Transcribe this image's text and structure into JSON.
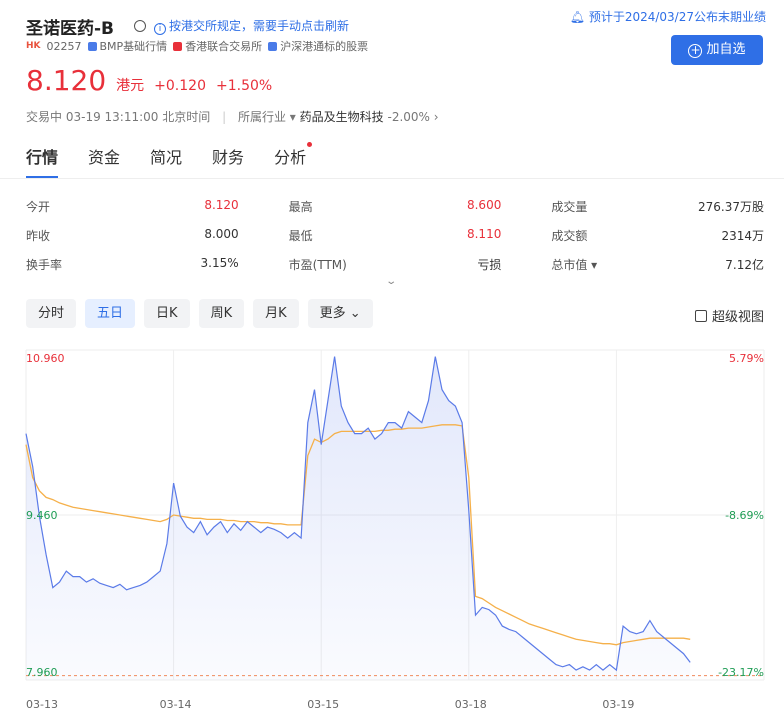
{
  "header": {
    "title": "圣诺医药-B",
    "notice": "按港交所规定，需要手动点击刷新",
    "forecast": "预计于2024/03/27公布末期业绩",
    "add_button": "加自选"
  },
  "tags": {
    "market": "HK",
    "code": "02257",
    "bmp": "BMP基础行情",
    "exchange": "香港联合交易所",
    "connect": "沪深港通标的股票"
  },
  "quote": {
    "price": "8.120",
    "currency": "港元",
    "change": "+0.120",
    "change_pct": "+1.50%"
  },
  "status": {
    "state": "交易中",
    "time": "03-19 13:11:00 北京时间",
    "industry_label": "所属行业",
    "industry": "药品及生物科技",
    "industry_chg": "-2.00%"
  },
  "tabs": [
    "行情",
    "资金",
    "简况",
    "财务",
    "分析"
  ],
  "stats": [
    [
      {
        "label": "今开",
        "value": "8.120",
        "red": true
      },
      {
        "label": "最高",
        "value": "8.600",
        "red": true
      },
      {
        "label": "成交量",
        "value": "276.37万股",
        "red": false
      }
    ],
    [
      {
        "label": "昨收",
        "value": "8.000",
        "red": false
      },
      {
        "label": "最低",
        "value": "8.110",
        "red": true
      },
      {
        "label": "成交额",
        "value": "2314万",
        "red": false
      }
    ],
    [
      {
        "label": "换手率",
        "value": "3.15%",
        "red": false
      },
      {
        "label": "市盈(TTM)",
        "value": "亏损",
        "red": false
      },
      {
        "label": "总市值 ▾",
        "value": "7.12亿",
        "red": false
      }
    ]
  ],
  "periods": [
    "分时",
    "五日",
    "日K",
    "周K",
    "月K",
    "更多"
  ],
  "super_view": "超级视图",
  "colors": {
    "accent": "#2f6fe6",
    "up": "#e8303a",
    "down": "#1f9d55",
    "price_line": "#5b7be8",
    "avg_line": "#f5b04a"
  },
  "chart_data": {
    "type": "line",
    "title": "",
    "x_labels": [
      "03-13",
      "03-14",
      "03-15",
      "03-18",
      "03-19"
    ],
    "ylim": [
      7.96,
      10.96
    ],
    "y_labels_left": [
      "10.960",
      "9.460",
      "7.960"
    ],
    "y_labels_right": [
      "5.79%",
      "-8.69%",
      "-23.17%"
    ],
    "prev_close": 8.0,
    "series": [
      {
        "values": [
          10.2,
          9.9,
          9.45,
          9.1,
          8.8,
          8.85,
          8.95,
          8.9,
          8.9,
          8.85,
          8.88,
          8.84,
          8.82,
          8.8,
          8.83,
          8.78,
          8.8,
          8.82,
          8.85,
          8.9,
          8.95,
          9.2,
          9.75,
          9.45,
          9.35,
          9.3,
          9.4,
          9.28,
          9.35,
          9.4,
          9.3,
          9.38,
          9.32,
          9.4,
          9.35,
          9.3,
          9.35,
          9.33,
          9.3,
          9.25,
          9.3,
          9.25,
          10.3,
          10.6,
          10.1,
          10.5,
          10.9,
          10.45,
          10.3,
          10.2,
          10.2,
          10.25,
          10.15,
          10.2,
          10.3,
          10.3,
          10.25,
          10.4,
          10.35,
          10.3,
          10.5,
          10.9,
          10.6,
          10.5,
          10.45,
          10.3,
          9.5,
          8.55,
          8.62,
          8.6,
          8.55,
          8.45,
          8.42,
          8.4,
          8.35,
          8.3,
          8.25,
          8.2,
          8.15,
          8.1,
          8.08,
          8.1,
          8.05,
          8.08,
          8.05,
          8.1,
          8.05,
          8.1,
          8.05,
          8.45,
          8.4,
          8.38,
          8.4,
          8.5,
          8.4,
          8.35,
          8.3,
          8.25,
          8.2,
          8.12
        ]
      },
      {
        "values": [
          10.1,
          9.8,
          9.68,
          9.62,
          9.6,
          9.57,
          9.55,
          9.53,
          9.52,
          9.51,
          9.5,
          9.49,
          9.48,
          9.47,
          9.46,
          9.45,
          9.44,
          9.43,
          9.42,
          9.41,
          9.4,
          9.42,
          9.46,
          9.45,
          9.44,
          9.43,
          9.43,
          9.42,
          9.42,
          9.42,
          9.41,
          9.41,
          9.4,
          9.4,
          9.4,
          9.39,
          9.39,
          9.38,
          9.38,
          9.37,
          9.37,
          9.37,
          10.0,
          10.15,
          10.12,
          10.15,
          10.2,
          10.22,
          10.22,
          10.22,
          10.22,
          10.22,
          10.22,
          10.23,
          10.23,
          10.24,
          10.24,
          10.25,
          10.25,
          10.25,
          10.26,
          10.27,
          10.28,
          10.28,
          10.28,
          10.27,
          9.8,
          8.72,
          8.7,
          8.66,
          8.62,
          8.59,
          8.56,
          8.53,
          8.5,
          8.47,
          8.45,
          8.43,
          8.41,
          8.39,
          8.37,
          8.35,
          8.33,
          8.32,
          8.31,
          8.3,
          8.29,
          8.29,
          8.28,
          8.3,
          8.31,
          8.32,
          8.33,
          8.34,
          8.34,
          8.34,
          8.34,
          8.34,
          8.34,
          8.33
        ]
      }
    ]
  }
}
